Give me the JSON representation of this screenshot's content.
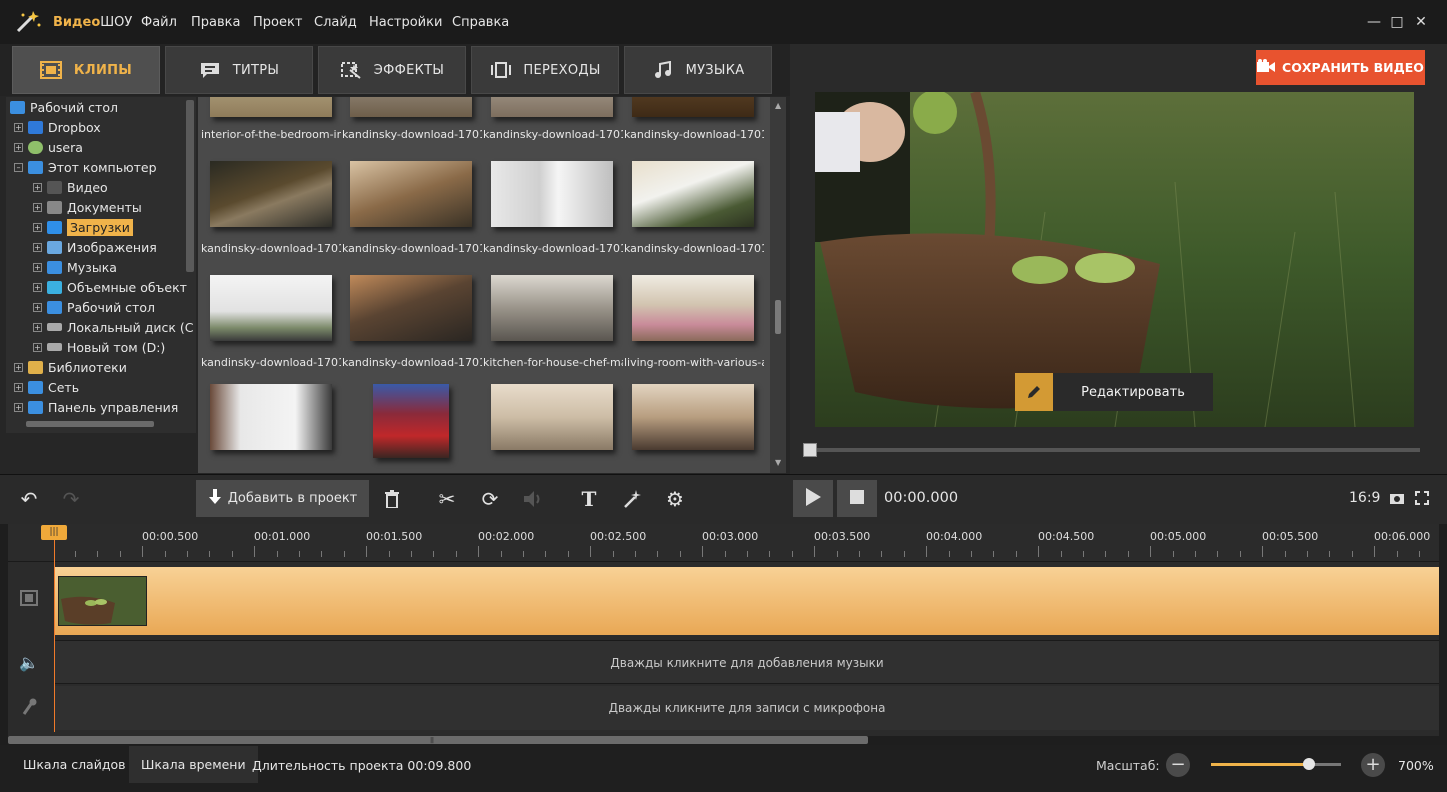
{
  "app": {
    "title_brand": "Видео",
    "title_rest": "ШОУ"
  },
  "menu": [
    "Файл",
    "Правка",
    "Проект",
    "Слайд",
    "Настройки",
    "Справка"
  ],
  "tabs": [
    {
      "label": "КЛИПЫ",
      "icon": "film-icon"
    },
    {
      "label": "ТИТРЫ",
      "icon": "titles-icon"
    },
    {
      "label": "ЭФФЕКТЫ",
      "icon": "effects-icon"
    },
    {
      "label": "ПЕРЕХОДЫ",
      "icon": "transitions-icon"
    },
    {
      "label": "МУЗЫКА",
      "icon": "music-icon"
    }
  ],
  "tree": [
    {
      "label": "Рабочий стол",
      "icon": "desktop-icon",
      "color": "#3b8fe0"
    },
    {
      "label": "Dropbox",
      "icon": "dropbox-icon",
      "color": "#2f79d8"
    },
    {
      "label": "usera",
      "icon": "user-icon",
      "color": "#8fbf6a"
    },
    {
      "label": "Этот компьютер",
      "icon": "computer-icon",
      "color": "#3b8fe0"
    },
    {
      "label": "Видео",
      "icon": "video-folder-icon",
      "color": "#555"
    },
    {
      "label": "Документы",
      "icon": "documents-icon",
      "color": "#888"
    },
    {
      "label": "Загрузки",
      "icon": "downloads-icon",
      "color": "#2f8fe8"
    },
    {
      "label": "Изображения",
      "icon": "images-icon",
      "color": "#6aa8e0"
    },
    {
      "label": "Музыка",
      "icon": "music-folder-icon",
      "color": "#3b8fe0"
    },
    {
      "label": "Объемные объект",
      "icon": "3d-objects-icon",
      "color": "#3bb0e0"
    },
    {
      "label": "Рабочий стол",
      "icon": "desktop-icon",
      "color": "#3b8fe0"
    },
    {
      "label": "Локальный диск (С",
      "icon": "disk-icon",
      "color": "#aaa"
    },
    {
      "label": "Новый том (D:)",
      "icon": "disk-icon",
      "color": "#aaa"
    },
    {
      "label": "Библиотеки",
      "icon": "libraries-icon",
      "color": "#e0b04a"
    },
    {
      "label": "Сеть",
      "icon": "network-icon",
      "color": "#3b8fe0"
    },
    {
      "label": "Панель управления",
      "icon": "control-panel-icon",
      "color": "#3b8fe0"
    }
  ],
  "files": {
    "row1_labels": [
      "interior-of-the-bedroom-in...",
      "kandinsky-download-1701...",
      "kandinsky-download-1701...",
      "kandinsky-download-1701..."
    ],
    "row2_labels": [
      "kandinsky-download-1701...",
      "kandinsky-download-1701...",
      "kandinsky-download-1701...",
      "kandinsky-download-1701..."
    ],
    "row3_labels": [
      "kandinsky-download-1701...",
      "kandinsky-download-1701...",
      "kitchen-for-house-chef-ma...",
      "living-room-with-various-a..."
    ]
  },
  "preview": {
    "save_label": "СОХРАНИТЬ ВИДЕО",
    "edit_label": "Редактировать"
  },
  "toolbar": {
    "add_label": "Добавить в проект",
    "timecode": "00:00.000",
    "aspect": "16:9"
  },
  "timeline": {
    "ticks": [
      "00:00.500",
      "00:01.000",
      "00:01.500",
      "00:02.000",
      "00:02.500",
      "00:03.000",
      "00:03.500",
      "00:04.000",
      "00:04.500",
      "00:05.000",
      "00:05.500",
      "00:06.000"
    ],
    "music_hint": "Дважды кликните для добавления музыки",
    "mic_hint": "Дважды кликните для записи с микрофона"
  },
  "status": {
    "slides_tab": "Шкала слайдов",
    "timeline_tab": "Шкала времени",
    "duration": "Длительность проекта 00:09.800",
    "scale_label": "Масштаб:",
    "zoom_value": "700%",
    "zoom_fraction": 0.75
  }
}
